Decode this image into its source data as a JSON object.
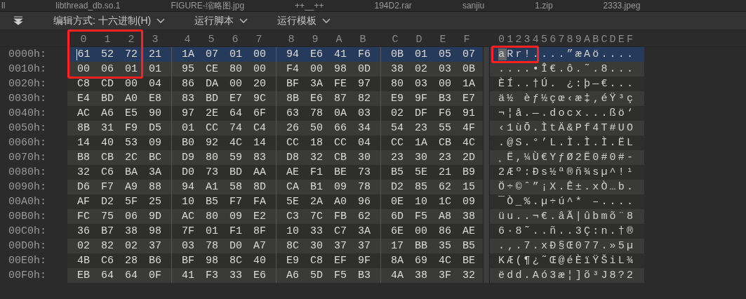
{
  "file_tabs": [
    "ll",
    "libthread_db.so.1",
    "FIGURE-缩略图.jpg",
    "++__++",
    "194D2.rar",
    "sanjiu",
    "1.zip",
    "2333.jpeg"
  ],
  "toolbar": [
    {
      "label": "编辑方式: 十六进制(H)"
    },
    {
      "label": "运行脚本"
    },
    {
      "label": "运行模板"
    }
  ],
  "hex_header": [
    "0",
    "1",
    "2",
    "3",
    "4",
    "5",
    "6",
    "7",
    "8",
    "9",
    "A",
    "B",
    "C",
    "D",
    "E",
    "F"
  ],
  "ascii_header": "0123456789ABCDEF",
  "rows": [
    {
      "offset": "0000h:",
      "bytes": [
        "61",
        "52",
        "72",
        "21",
        "1A",
        "07",
        "01",
        "00",
        "94",
        "E6",
        "41",
        "F6",
        "0B",
        "01",
        "05",
        "07"
      ],
      "ascii": "aRr!....”æAö....",
      "selected": true,
      "cursor": true
    },
    {
      "offset": "0010h:",
      "bytes": [
        "00",
        "06",
        "01",
        "01",
        "95",
        "CE",
        "80",
        "00",
        "F4",
        "00",
        "98",
        "0D",
        "38",
        "02",
        "03",
        "0B"
      ],
      "ascii": "....•Î€.ô.˜.8...",
      "selected": false,
      "cursor": false
    },
    {
      "offset": "0020h:",
      "bytes": [
        "C8",
        "CD",
        "00",
        "04",
        "86",
        "DA",
        "00",
        "20",
        "BF",
        "3A",
        "FE",
        "97",
        "80",
        "03",
        "00",
        "1A"
      ],
      "ascii": "ÈÍ..†Ú. ¿:þ—€...",
      "selected": false,
      "cursor": false
    },
    {
      "offset": "0030h:",
      "bytes": [
        "E4",
        "BD",
        "A0",
        "E8",
        "83",
        "BD",
        "E7",
        "9C",
        "8B",
        "E6",
        "87",
        "82",
        "E9",
        "9F",
        "B3",
        "E7"
      ],
      "ascii": "ä½ èƒ½çœ‹æ‡‚éŸ³ç",
      "selected": false,
      "cursor": false
    },
    {
      "offset": "0040h:",
      "bytes": [
        "AC",
        "A6",
        "E5",
        "90",
        "97",
        "2E",
        "64",
        "6F",
        "63",
        "78",
        "0A",
        "03",
        "02",
        "DF",
        "F6",
        "91"
      ],
      "ascii": "¬¦å.—.docx...ßö‘",
      "selected": false,
      "cursor": false
    },
    {
      "offset": "0050h:",
      "bytes": [
        "8B",
        "31",
        "F9",
        "D5",
        "01",
        "CC",
        "74",
        "C4",
        "26",
        "50",
        "66",
        "34",
        "54",
        "23",
        "55",
        "4F"
      ],
      "ascii": "‹1ùÕ.ÌtÄ&Pf4T#UO",
      "selected": false,
      "cursor": false
    },
    {
      "offset": "0060h:",
      "bytes": [
        "14",
        "40",
        "53",
        "09",
        "B0",
        "92",
        "4C",
        "14",
        "CC",
        "18",
        "CC",
        "04",
        "CC",
        "1A",
        "CB",
        "4C"
      ],
      "ascii": ".@S.°’L.Ì.Ì.Ì.ËL",
      "selected": false,
      "cursor": false
    },
    {
      "offset": "0070h:",
      "bytes": [
        "B8",
        "CB",
        "2C",
        "BC",
        "D9",
        "80",
        "59",
        "83",
        "D8",
        "32",
        "CB",
        "30",
        "23",
        "30",
        "23",
        "2D"
      ],
      "ascii": "¸Ë,¼Ù€YƒØ2Ë0#0#-",
      "selected": false,
      "cursor": false
    },
    {
      "offset": "0080h:",
      "bytes": [
        "32",
        "C6",
        "BA",
        "3A",
        "D0",
        "73",
        "BD",
        "AA",
        "AE",
        "F1",
        "BE",
        "73",
        "B5",
        "5E",
        "21",
        "B9"
      ],
      "ascii": "2Æº:Ðs½ª®ñ¾sµ^!¹",
      "selected": false,
      "cursor": false
    },
    {
      "offset": "0090h:",
      "bytes": [
        "D6",
        "F7",
        "A9",
        "88",
        "94",
        "A1",
        "58",
        "8D",
        "CA",
        "B1",
        "09",
        "78",
        "D2",
        "85",
        "62",
        "15"
      ],
      "ascii": "Ö÷©ˆ”¡X.Ê±.xÒ…b.",
      "selected": false,
      "cursor": false
    },
    {
      "offset": "00A0h:",
      "bytes": [
        "AF",
        "D2",
        "5F",
        "25",
        "10",
        "B5",
        "F7",
        "FA",
        "5E",
        "2A",
        "A0",
        "96",
        "0E",
        "10",
        "1C",
        "09"
      ],
      "ascii": "¯Ò_%.µ÷ú^* –....",
      "selected": false,
      "cursor": false
    },
    {
      "offset": "00B0h:",
      "bytes": [
        "FC",
        "75",
        "06",
        "9D",
        "AC",
        "80",
        "09",
        "E2",
        "C3",
        "7C",
        "FB",
        "62",
        "6D",
        "F5",
        "A8",
        "38"
      ],
      "ascii": "üu..¬€.âÃ|ûbmõ¨8",
      "selected": false,
      "cursor": false
    },
    {
      "offset": "00C0h:",
      "bytes": [
        "36",
        "B7",
        "38",
        "98",
        "7F",
        "01",
        "F1",
        "8F",
        "10",
        "33",
        "C7",
        "3A",
        "6E",
        "00",
        "86",
        "AE"
      ],
      "ascii": "6·8˜..ñ..3Ç:n.†®",
      "selected": false,
      "cursor": false
    },
    {
      "offset": "00D0h:",
      "bytes": [
        "02",
        "82",
        "02",
        "37",
        "03",
        "78",
        "D0",
        "A7",
        "8C",
        "30",
        "37",
        "37",
        "17",
        "BB",
        "35",
        "B5"
      ],
      "ascii": ".‚.7.xÐ§Œ077.»5µ",
      "selected": false,
      "cursor": false
    },
    {
      "offset": "00E0h:",
      "bytes": [
        "4B",
        "C6",
        "28",
        "B6",
        "BF",
        "98",
        "8C",
        "40",
        "E9",
        "C8",
        "EF",
        "9F",
        "8A",
        "69",
        "4C",
        "BE"
      ],
      "ascii": "KÆ(¶¿˜Œ@éÈïŸŠiL¾",
      "selected": false,
      "cursor": false
    },
    {
      "offset": "00F0h:",
      "bytes": [
        "EB",
        "64",
        "64",
        "0F",
        "41",
        "F3",
        "33",
        "E6",
        "A6",
        "5D",
        "F5",
        "B3",
        "4A",
        "38",
        "3F",
        "32"
      ],
      "ascii": "ëdd.Aó3æ¦]õ³J8?2",
      "selected": false,
      "cursor": false
    }
  ]
}
